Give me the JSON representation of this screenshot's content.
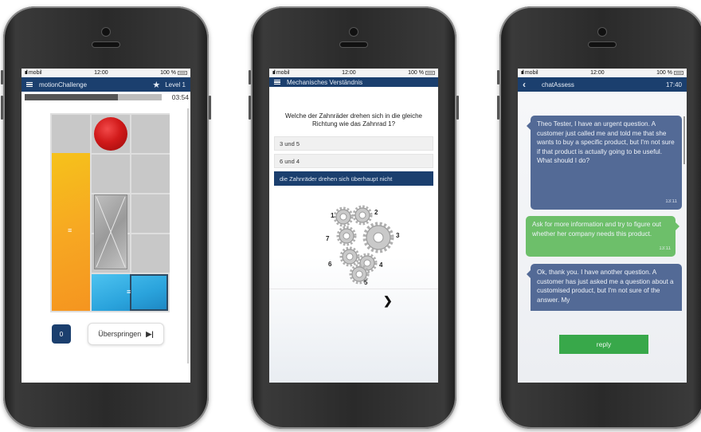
{
  "status": {
    "carrier": "mobil",
    "time": "12:00",
    "battery": "100 %"
  },
  "screen1": {
    "app_title": "motionChallenge",
    "level": "Level 1",
    "timer": "03:54",
    "progress": 0.68,
    "score": "0",
    "skip_label": "Überspringen",
    "colors": {
      "orange": "#f7a822",
      "blue": "#2aa3dc",
      "red": "#d11a1a"
    }
  },
  "screen2": {
    "app_title": "Mechanisches Verständnis",
    "question": "Welche der Zahnräder drehen sich in die gleiche Richtung wie das Zahnrad 1?",
    "options": [
      {
        "label": "3 und 5",
        "selected": false
      },
      {
        "label": "6 und 4",
        "selected": false
      },
      {
        "label": "die Zahnräder drehen sich überhaupt nicht",
        "selected": true
      }
    ],
    "gear_labels": [
      "1",
      "2",
      "3",
      "4",
      "5",
      "6",
      "7"
    ]
  },
  "screen3": {
    "app_title": "chatAssess",
    "header_time": "17:40",
    "messages": [
      {
        "from": "other",
        "text": "Theo Tester, I have an urgent question. A customer just called me and told me that she wants to buy a specific product, but I'm not sure if that product is actually going to be useful. What should I do?",
        "time": "13:11"
      },
      {
        "from": "me",
        "text": "Ask for more information and try to figure out whether her company needs this product.",
        "time": "13:11"
      },
      {
        "from": "other",
        "text": "Ok, thank you. I have another question. A customer has just asked me a question about a customised product, but I'm not sure of the answer. My",
        "time": ""
      }
    ],
    "reply_label": "reply",
    "colors": {
      "incoming": "#536a96",
      "outgoing": "#6dbf6a",
      "reply": "#38a84a"
    }
  }
}
